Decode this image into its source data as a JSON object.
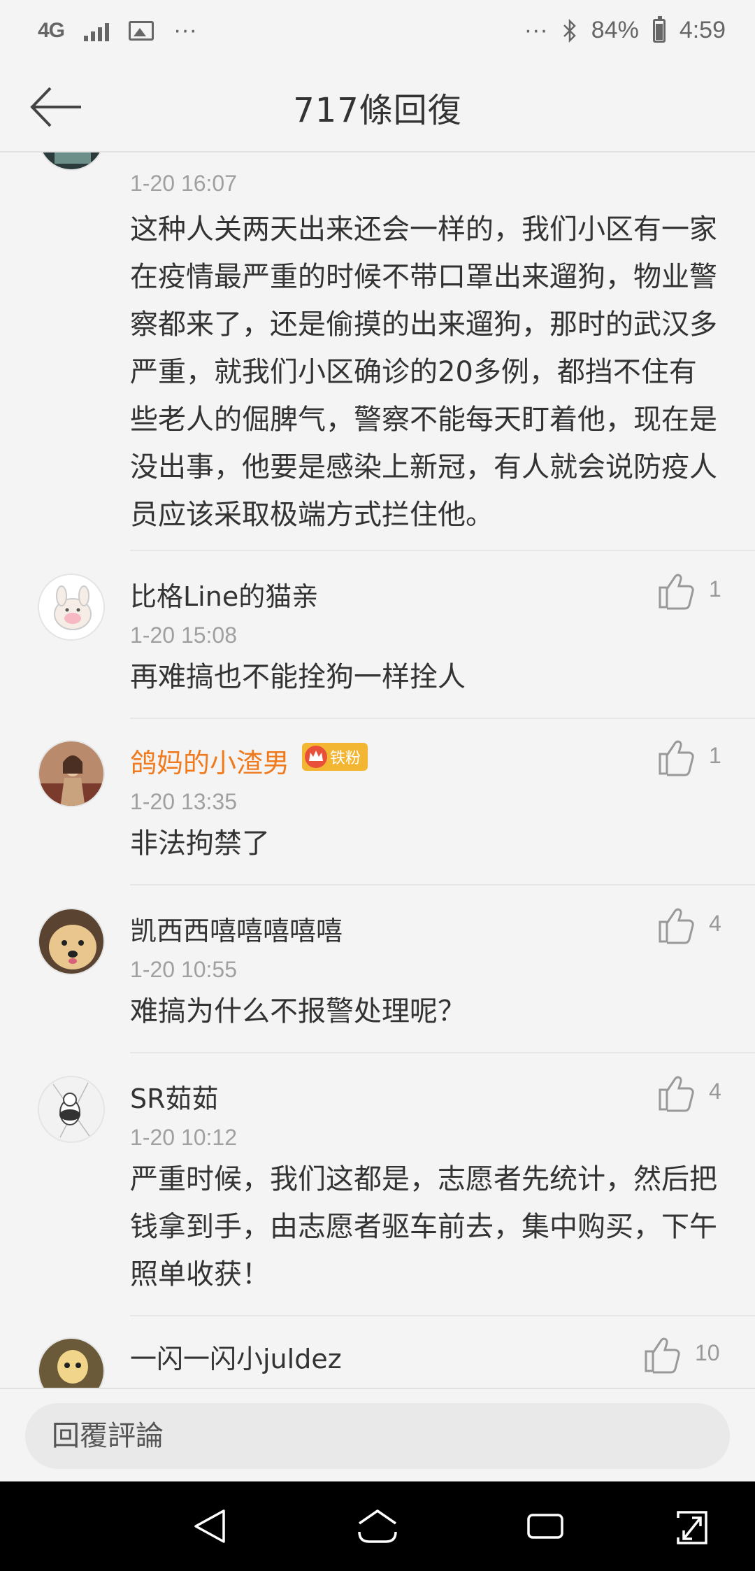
{
  "status_bar": {
    "network": "4G",
    "more_left": "···",
    "more_right": "···",
    "battery": "84%",
    "time": "4:59",
    "icons": [
      "signal-icon",
      "image-icon",
      "bluetooth-icon",
      "battery-icon"
    ]
  },
  "header": {
    "title": "717條回復",
    "back_icon": "arrow-left-icon"
  },
  "comments": [
    {
      "username": "",
      "time": "1-20 16:07",
      "text": "这种人关两天出来还会一样的，我们小区有一家在疫情最严重的时候不带口罩出来遛狗，物业警察都来了，还是偷摸的出来遛狗，那时的武汉多严重，就我们小区确诊的20多例，都挡不住有些老人的倔脾气，警察不能每天盯着他，现在是没出事，他要是感染上新冠，有人就会说防疫人员应该采取极端方式拦住他。"
    },
    {
      "username": "比格Line的猫亲",
      "time": "1-20 15:08",
      "text": "再难搞也不能拴狗一样拴人",
      "likes": "1"
    },
    {
      "username": "鸽妈的小渣男",
      "badge": "铁粉",
      "time": "1-20 13:35",
      "text": "非法拘禁了",
      "likes": "1",
      "username_color": "#f07b1e"
    },
    {
      "username": "凯西西嘻嘻嘻嘻嘻",
      "time": "1-20 10:55",
      "text": "难搞为什么不报警处理呢？",
      "likes": "4"
    },
    {
      "username": "SR茹茹",
      "time": "1-20 10:12",
      "text": "严重时候，我们这都是，志愿者先统计，然后把钱拿到手，由志愿者驱车前去，集中购买，下午照单收获！",
      "likes": "4"
    },
    {
      "username": "一闪一闪小juldez",
      "likes": "10"
    }
  ],
  "reply_bar": {
    "placeholder": "回覆評論"
  },
  "nav_bar": {
    "icons": [
      "back-triangle-icon",
      "home-icon",
      "recents-icon",
      "expand-icon"
    ]
  },
  "colors": {
    "background": "#f4f4f4",
    "vip_username": "#f07b1e",
    "badge": "#f3b633",
    "timestamp": "#a0a0a0"
  }
}
